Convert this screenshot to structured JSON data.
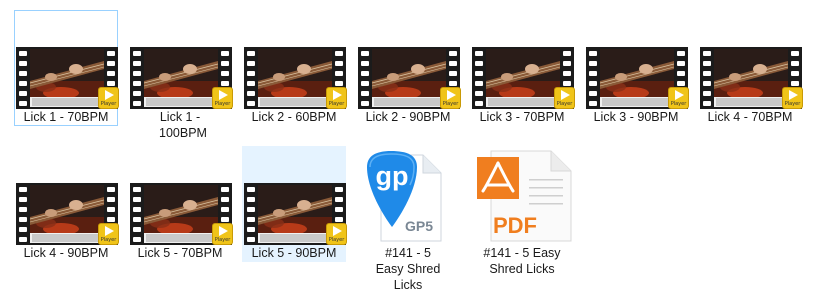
{
  "colors": {
    "selection_bg": "#e5f3ff",
    "focus_border": "#99d1ff",
    "player_badge": "#f0c419",
    "gp_blue": "#1f8ae8",
    "pdf_orange": "#f07e1f"
  },
  "files": [
    {
      "name": "Lick 1 - 70BPM",
      "type": "video",
      "icon": "video-file-icon",
      "badge": "Player",
      "state": "focused"
    },
    {
      "name": "Lick 1 - 100BPM",
      "type": "video",
      "icon": "video-file-icon",
      "badge": "Player",
      "state": "normal"
    },
    {
      "name": "Lick 2 - 60BPM",
      "type": "video",
      "icon": "video-file-icon",
      "badge": "Player",
      "state": "normal"
    },
    {
      "name": "Lick 2 - 90BPM",
      "type": "video",
      "icon": "video-file-icon",
      "badge": "Player",
      "state": "normal"
    },
    {
      "name": "Lick 3 - 70BPM",
      "type": "video",
      "icon": "video-file-icon",
      "badge": "Player",
      "state": "normal"
    },
    {
      "name": "Lick 3 - 90BPM",
      "type": "video",
      "icon": "video-file-icon",
      "badge": "Player",
      "state": "normal"
    },
    {
      "name": "Lick 4 - 70BPM",
      "type": "video",
      "icon": "video-file-icon",
      "badge": "Player",
      "state": "normal"
    },
    {
      "name": "Lick 4 - 90BPM",
      "type": "video",
      "icon": "video-file-icon",
      "badge": "Player",
      "state": "normal"
    },
    {
      "name": "Lick 5 - 70BPM",
      "type": "video",
      "icon": "video-file-icon",
      "badge": "Player",
      "state": "normal"
    },
    {
      "name": "Lick 5 - 90BPM",
      "type": "video",
      "icon": "video-file-icon",
      "badge": "Player",
      "state": "selected"
    },
    {
      "name": "#141 - 5 Easy Shred Licks",
      "type": "gp5",
      "icon": "guitar-pro-file-icon",
      "icon_text": "gp",
      "badge": "GP5",
      "state": "normal"
    },
    {
      "name": "#141 - 5 Easy Shred Licks",
      "type": "pdf",
      "icon": "pdf-file-icon",
      "badge": "PDF",
      "state": "normal"
    }
  ]
}
